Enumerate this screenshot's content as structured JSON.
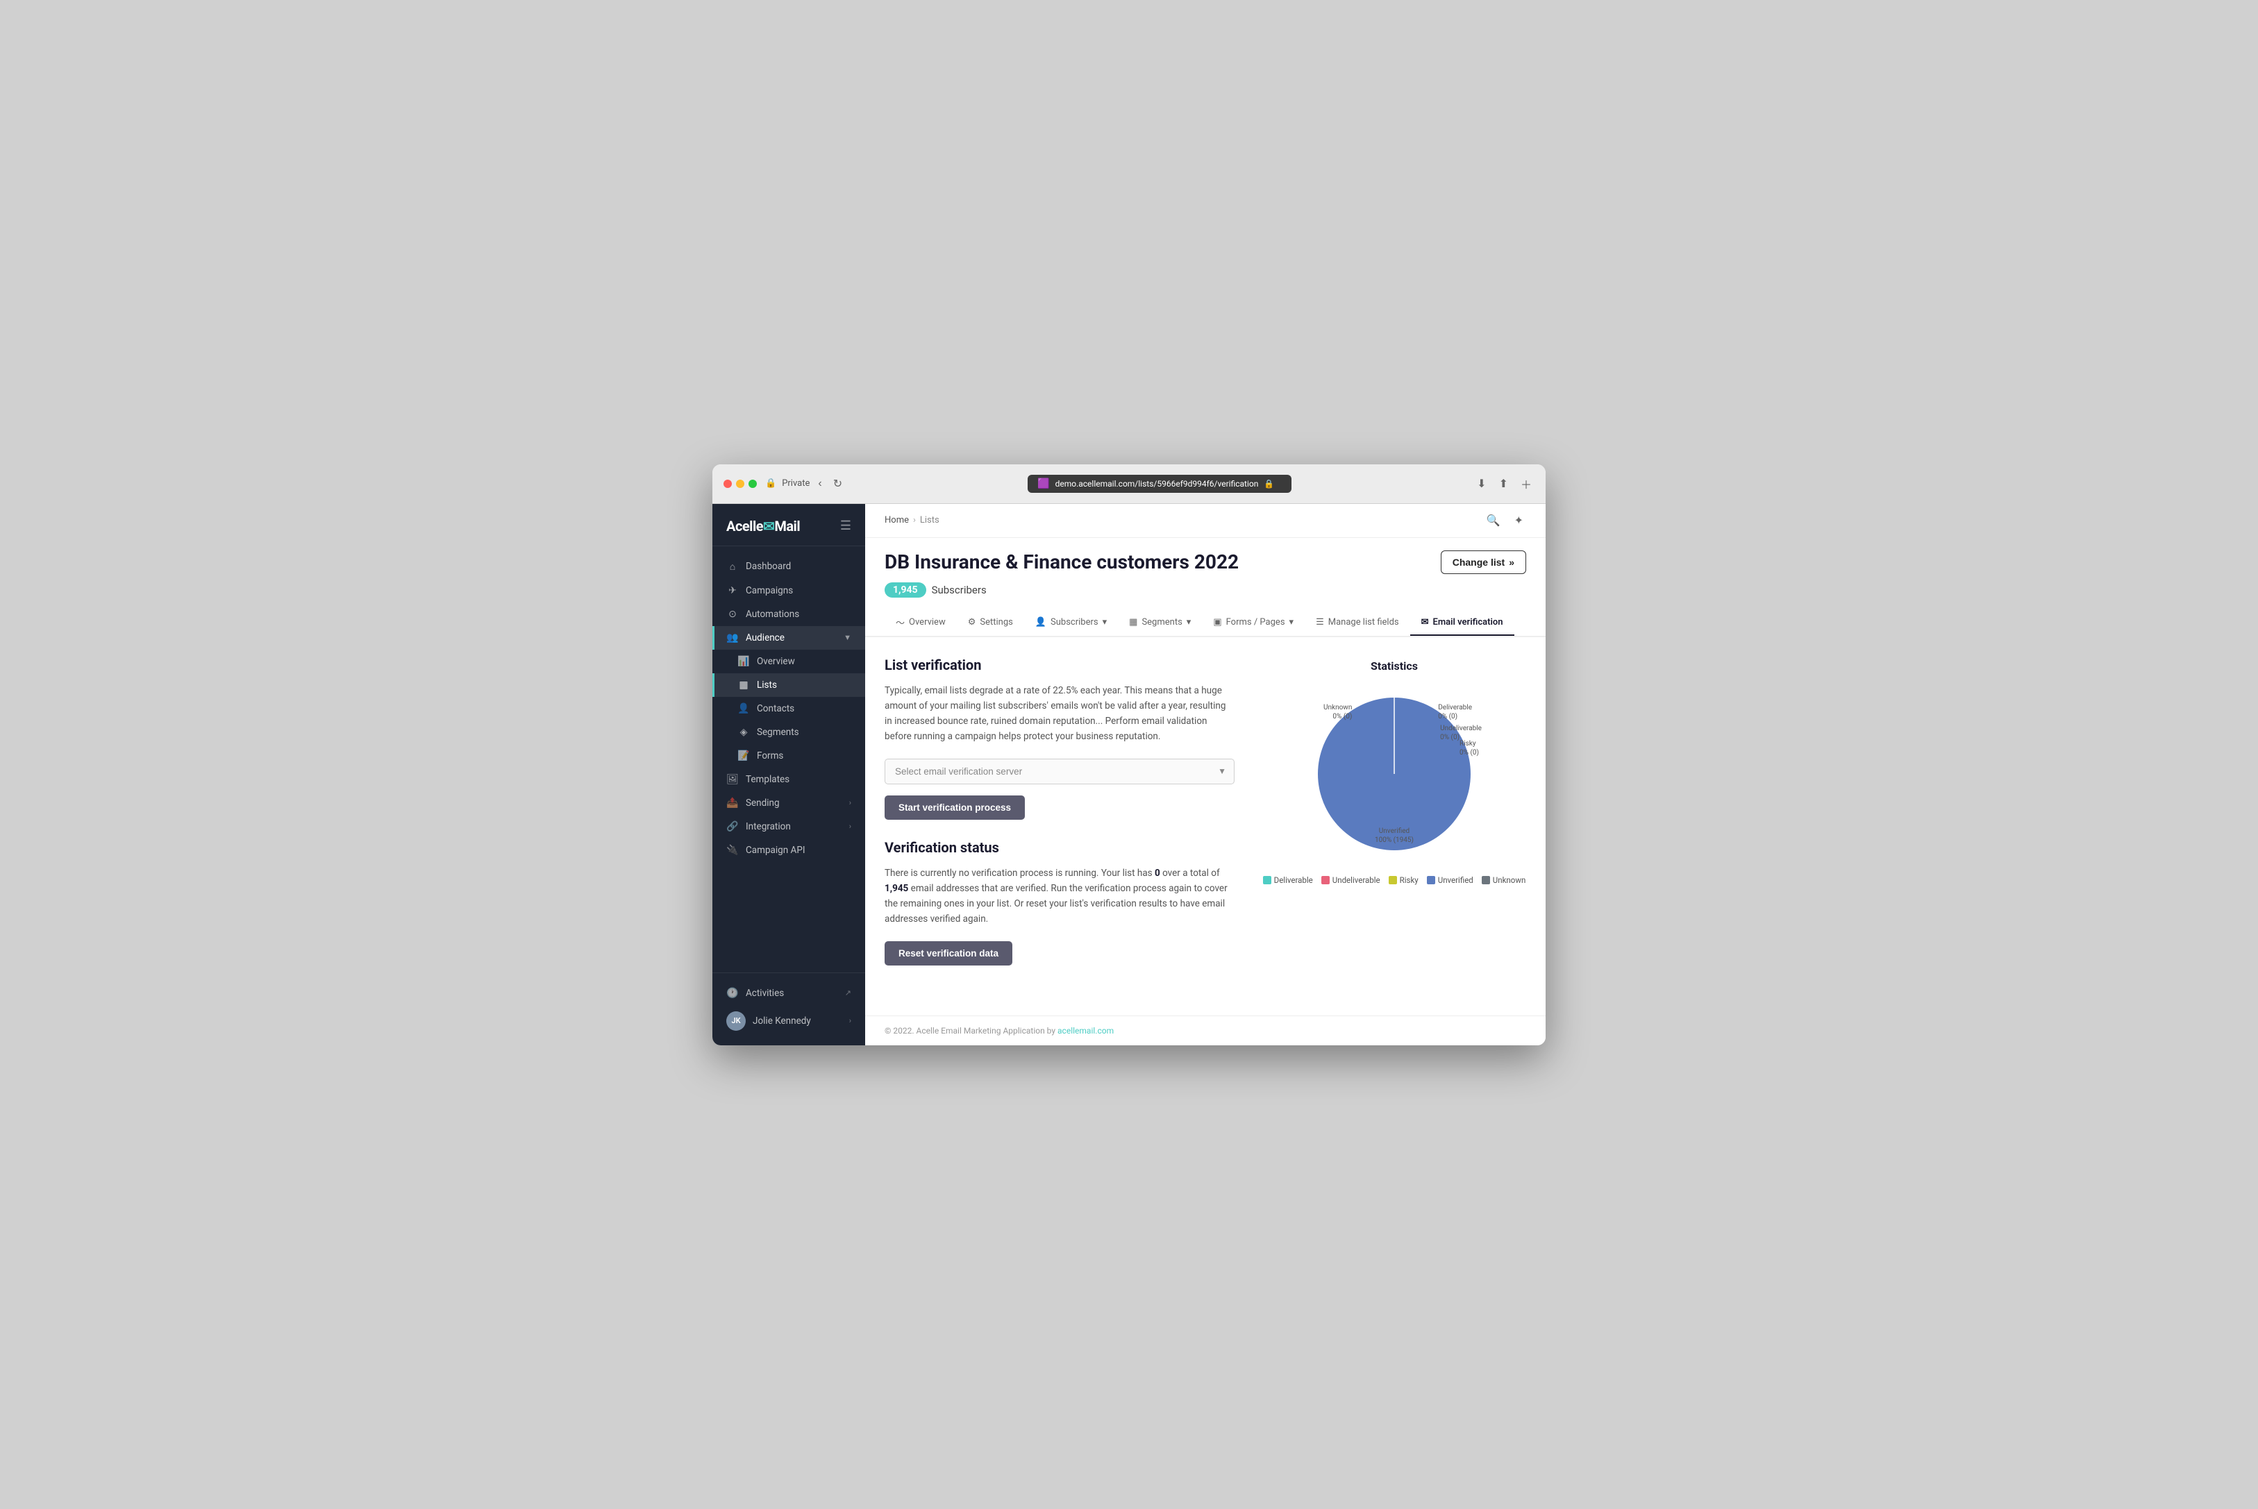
{
  "browser": {
    "private_label": "Private",
    "url": "demo.acellemail.com/lists/5966ef9d994f6/verification"
  },
  "app": {
    "logo": "Acelle Mail"
  },
  "sidebar": {
    "nav_items": [
      {
        "id": "dashboard",
        "icon": "🏠",
        "label": "Dashboard",
        "active": false,
        "has_chevron": false
      },
      {
        "id": "campaigns",
        "icon": "✈",
        "label": "Campaigns",
        "active": false,
        "has_chevron": false
      },
      {
        "id": "automations",
        "icon": "⚙",
        "label": "Automations",
        "active": false,
        "has_chevron": false
      },
      {
        "id": "audience",
        "icon": "👥",
        "label": "Audience",
        "active": true,
        "has_chevron": true
      },
      {
        "id": "overview",
        "icon": "📊",
        "label": "Overview",
        "active": false,
        "has_chevron": false,
        "indent": true
      },
      {
        "id": "lists",
        "icon": "📋",
        "label": "Lists",
        "active": true,
        "has_chevron": false,
        "indent": true
      },
      {
        "id": "contacts",
        "icon": "👤",
        "label": "Contacts",
        "active": false,
        "has_chevron": false,
        "indent": true
      },
      {
        "id": "segments",
        "icon": "🔷",
        "label": "Segments",
        "active": false,
        "has_chevron": false,
        "indent": true
      },
      {
        "id": "forms",
        "icon": "📝",
        "label": "Forms",
        "active": false,
        "has_chevron": false,
        "indent": true
      },
      {
        "id": "templates",
        "icon": "🖼",
        "label": "Templates",
        "active": false,
        "has_chevron": false
      },
      {
        "id": "sending",
        "icon": "📤",
        "label": "Sending",
        "active": false,
        "has_chevron": true
      },
      {
        "id": "integration",
        "icon": "🔗",
        "label": "Integration",
        "active": false,
        "has_chevron": true
      },
      {
        "id": "campaign_api",
        "icon": "🔌",
        "label": "Campaign API",
        "active": false,
        "has_chevron": false
      }
    ],
    "footer_items": [
      {
        "id": "activities",
        "icon": "🕐",
        "label": "Activities",
        "external": true
      },
      {
        "id": "user",
        "label": "Jolie Kennedy",
        "avatar": "JK"
      }
    ]
  },
  "breadcrumb": {
    "home": "Home",
    "separator": ">",
    "current": "Lists"
  },
  "page": {
    "title": "DB Insurance & Finance customers 2022",
    "subscribers_count": "1,945",
    "subscribers_label": "Subscribers",
    "change_list_label": "Change list"
  },
  "tabs": [
    {
      "id": "overview",
      "icon": "〜",
      "label": "Overview",
      "active": false
    },
    {
      "id": "settings",
      "icon": "⚙",
      "label": "Settings",
      "active": false
    },
    {
      "id": "subscribers",
      "icon": "👤",
      "label": "Subscribers",
      "active": false,
      "has_chevron": true
    },
    {
      "id": "segments",
      "icon": "▦",
      "label": "Segments",
      "active": false,
      "has_chevron": true
    },
    {
      "id": "forms_pages",
      "icon": "▣",
      "label": "Forms / Pages",
      "active": false,
      "has_chevron": true
    },
    {
      "id": "manage_list_fields",
      "icon": "☰",
      "label": "Manage list fields",
      "active": false
    },
    {
      "id": "email_verification",
      "icon": "✉",
      "label": "Email verification",
      "active": true
    }
  ],
  "list_verification": {
    "title": "List verification",
    "description": "Typically, email lists degrade at a rate of 22.5% each year. This means that a huge amount of your mailing list subscribers' emails won't be valid after a year, resulting in increased bounce rate, ruined domain reputation... Perform email validation before running a campaign helps protect your business reputation.",
    "select_placeholder": "Select email verification server",
    "start_btn": "Start verification process"
  },
  "verification_status": {
    "title": "Verification status",
    "text_part1": "There is currently no verification process is running. Your list has ",
    "verified_count": "0",
    "text_part2": " over a total of ",
    "total_count": "1,945",
    "text_part3": " email addresses that are verified. Run the verification process again to cover the remaining ones in your list. Or reset your list's verification results to have email addresses verified again.",
    "reset_btn": "Reset verification data"
  },
  "chart": {
    "title": "Statistics",
    "segments": [
      {
        "label": "Unknown",
        "value": "0% (0)",
        "color": "#6c757d",
        "percent": 0
      },
      {
        "label": "Deliverable",
        "value": "0% (0)",
        "color": "#4ecdc4",
        "percent": 0
      },
      {
        "label": "Undeliverable",
        "value": "0% (0)",
        "color": "#e8627a",
        "percent": 0
      },
      {
        "label": "Risky",
        "value": "0% (0)",
        "color": "#c8c830",
        "percent": 0
      },
      {
        "label": "Unverified",
        "value": "100% (1945)",
        "color": "#5a7bbf",
        "percent": 100
      }
    ],
    "legend": [
      {
        "label": "Deliverable",
        "color": "#4ecdc4"
      },
      {
        "label": "Undeliverable",
        "color": "#e8627a"
      },
      {
        "label": "Risky",
        "color": "#c8c830"
      },
      {
        "label": "Unverified",
        "color": "#5a7bbf"
      },
      {
        "label": "Unknown",
        "color": "#6c757d"
      }
    ]
  },
  "footer": {
    "text": "© 2022. Acelle Email Marketing Application by ",
    "link_text": "acellemail.com",
    "link_url": "acellemail.com"
  }
}
